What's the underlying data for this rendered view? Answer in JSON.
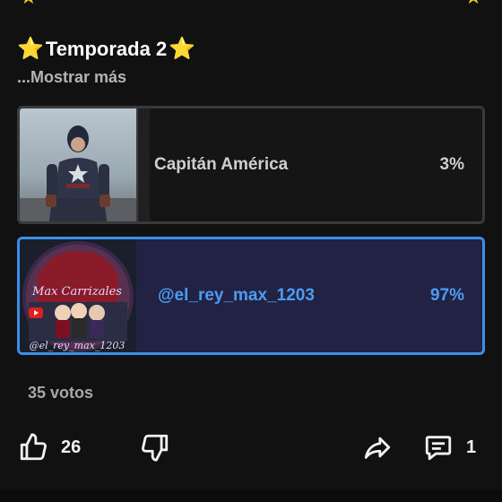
{
  "post": {
    "title": "Temporada 2",
    "more_link": "...Mostrar más"
  },
  "poll": {
    "options": [
      {
        "label": "Capitán América",
        "percent_text": "3%",
        "percent": 3,
        "selected": false
      },
      {
        "label": "@el_rey_max_1203",
        "percent_text": "97%",
        "percent": 97,
        "selected": true
      }
    ],
    "votes_text": "35 votos"
  },
  "actions": {
    "like_count": "26",
    "comment_count": "1"
  },
  "icons": {
    "title_star": "star-icon",
    "like": "thumbs-up-icon",
    "dislike": "thumbs-down-icon",
    "share": "share-arrow-icon",
    "comment": "comment-icon"
  },
  "colors": {
    "background": "#111112",
    "selected_border": "#3d8ee8",
    "selected_text": "#4c9df2",
    "star": "#f5c518"
  }
}
